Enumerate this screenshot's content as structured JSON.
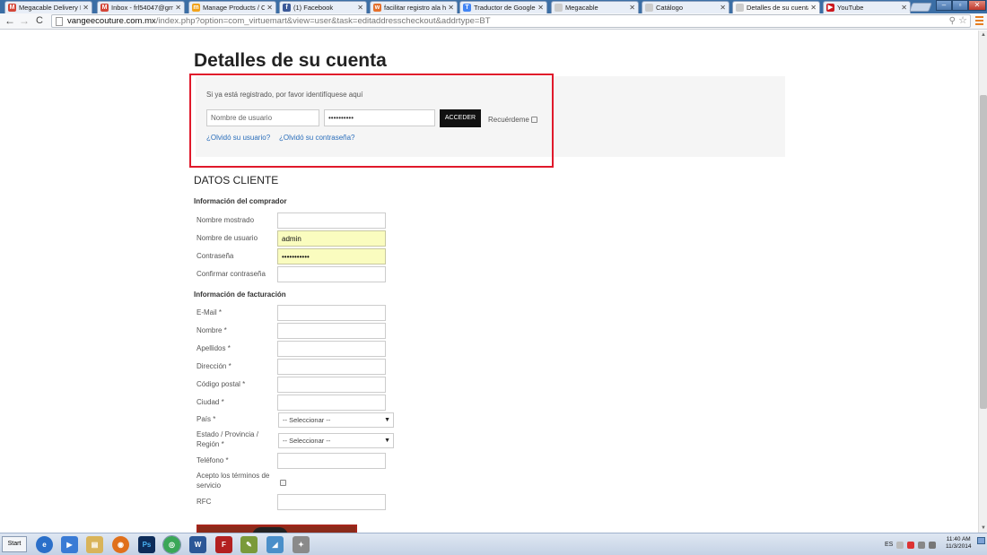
{
  "tabs": [
    {
      "title": "Megacable Delivery Lo",
      "fav_color": "#d44638",
      "fav_text": "M"
    },
    {
      "title": "Inbox - frl54047@gmail",
      "fav_color": "#d44638",
      "fav_text": "M"
    },
    {
      "title": "Manage Products / Cat",
      "fav_color": "#f2a31b",
      "fav_text": "m"
    },
    {
      "title": "(1) Facebook",
      "fav_color": "#3b5998",
      "fav_text": "f"
    },
    {
      "title": "facilitar registro ala ho",
      "fav_color": "#e5702c",
      "fav_text": "w"
    },
    {
      "title": "Traductor de Google",
      "fav_color": "#4285f4",
      "fav_text": "T"
    },
    {
      "title": "Megacable",
      "fav_color": "#cccccc",
      "fav_text": ""
    },
    {
      "title": "Catálogo",
      "fav_color": "#cccccc",
      "fav_text": ""
    },
    {
      "title": "Detalles de su cuenta",
      "fav_color": "#cccccc",
      "fav_text": ""
    },
    {
      "title": "YouTube",
      "fav_color": "#cc181e",
      "fav_text": "▶"
    }
  ],
  "browser": {
    "url_host": "vangeecouture.com.mx",
    "url_rest": "/index.php?option=com_virtuemart&view=user&task=editaddresscheckout&addrtype=BT"
  },
  "page": {
    "title": "Detalles de su cuenta",
    "login": {
      "note": "Si ya está registrado, por favor identifíquese aquí",
      "username_placeholder": "Nombre de usuario",
      "password_value": "••••••••••",
      "button": "ACCEDER",
      "remember": "Recuérdeme",
      "forgot_user": "¿Olvidó su usuario?",
      "forgot_pass": "¿Olvidó su contraseña?"
    },
    "section_title": "DATOS CLIENTE",
    "buyer_heading": "Información del comprador",
    "buyer_fields": [
      {
        "label": "Nombre mostrado",
        "value": ""
      },
      {
        "label": "Nombre de usuario",
        "value": "admin"
      },
      {
        "label": "Contraseña",
        "value": "•••••••••••"
      },
      {
        "label": "Confirmar contraseña",
        "value": ""
      }
    ],
    "billing_heading": "Información de facturación",
    "billing_fields": [
      {
        "label": "E-Mail *"
      },
      {
        "label": "Nombre *"
      },
      {
        "label": "Apellidos *"
      },
      {
        "label": "Dirección *"
      },
      {
        "label": "Código postal *"
      },
      {
        "label": "Ciudad *"
      }
    ],
    "country_label": "País *",
    "country_value": "-- Seleccionar --",
    "state_label_1": "Estado / Provincia /",
    "state_label_2": "Región *",
    "state_value": "-- Seleccionar --",
    "phone_label": "Teléfono *",
    "terms_label_1": "Acepto los términos de",
    "terms_label_2": "servicio",
    "rfc_label": "RFC"
  },
  "taskbar": {
    "start": "Start",
    "lang": "ES",
    "time": "11:40 AM",
    "date": "11/3/2014"
  }
}
